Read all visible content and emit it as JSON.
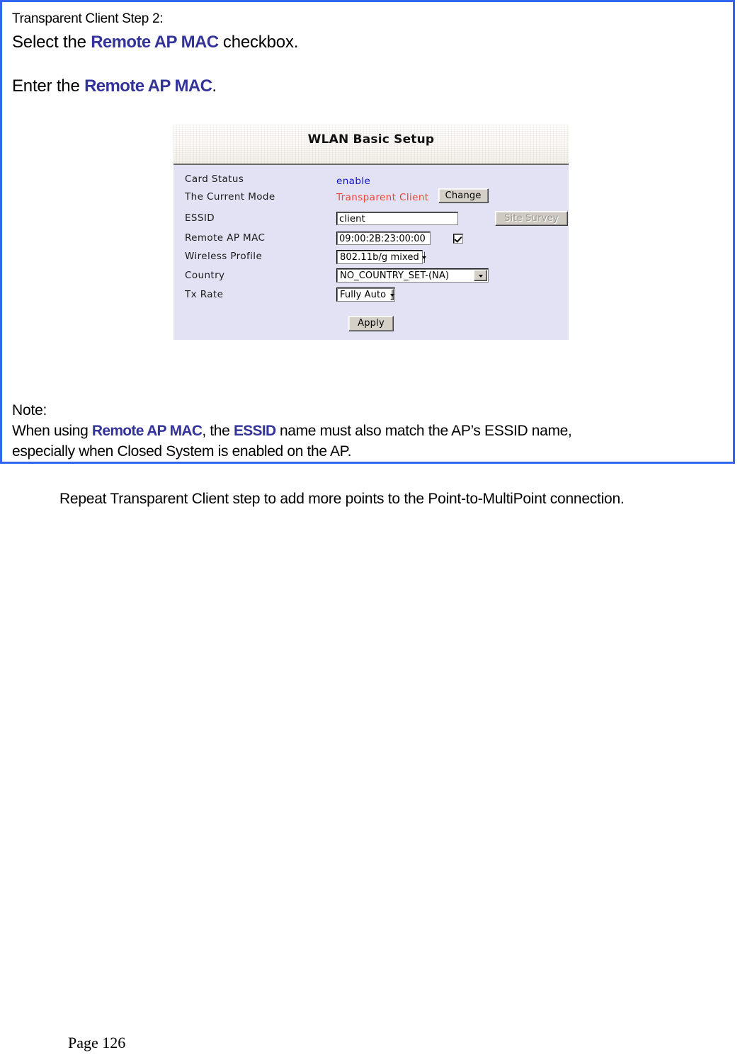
{
  "document": {
    "page_label": "Page 126"
  },
  "note_box": {
    "border_color": "#3366EE",
    "step_title": "Transparent Client Step 2:",
    "select_line": {
      "prefix": "Select the ",
      "keyword": "Remote AP MAC",
      "suffix": " checkbox."
    },
    "enter_line": {
      "prefix": "Enter the ",
      "keyword": "Remote AP MAC",
      "suffix": "."
    },
    "note": {
      "title": "Note:",
      "line1_part1": "When using ",
      "line1_keyword1": "Remote AP MAC",
      "line1_part2": ", the ",
      "line1_keyword2": "ESSID",
      "line1_part3": " name must also match the AP’s ESSID name,",
      "line2": "especially when Closed System is enabled on the AP."
    }
  },
  "wlan_panel": {
    "title": "WLAN Basic Setup",
    "header_bg": "#FBFAF7",
    "body_bg": "#E2E2F4",
    "fields": [
      {
        "label": "Card Status",
        "type": "text-value",
        "value": "enable",
        "color": "#1111CC"
      },
      {
        "label": "The Current Mode",
        "type": "text-value-button",
        "value": "Transparent Client",
        "color": "#EE4433",
        "button_label": "Change"
      },
      {
        "label": "ESSID",
        "type": "input-button",
        "value": "client",
        "placeholder": "",
        "button_label": "Site Survey",
        "button_disabled": true
      },
      {
        "label": "Remote AP MAC",
        "type": "input-checkbox",
        "value": "09:00:2B:23:00:00",
        "placeholder": "",
        "checkbox_checked": true
      },
      {
        "label": "Wireless Profile",
        "type": "select",
        "value": "802.11b/g mixed"
      },
      {
        "label": "Country",
        "type": "select",
        "value": "NO_COUNTRY_SET-(NA)"
      },
      {
        "label": "Tx Rate",
        "type": "select",
        "value": "Fully Auto"
      }
    ],
    "apply_label": "Apply"
  },
  "body_text": {
    "repeat_instruction": "Repeat Transparent Client step to add more points to the Point-to-MultiPoint connection."
  }
}
